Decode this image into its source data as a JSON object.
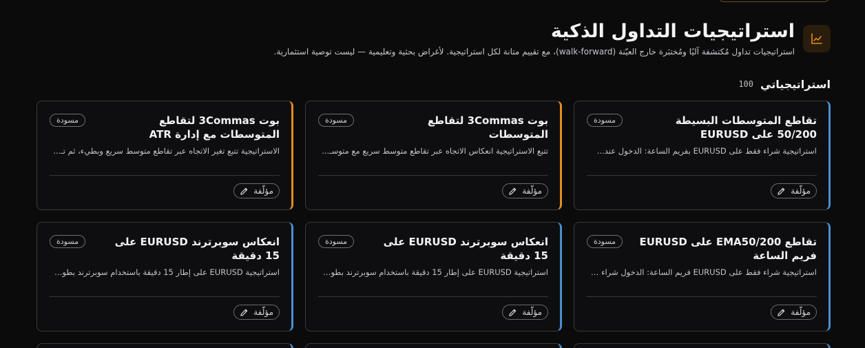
{
  "header": {
    "title": "استراتيجيات التداول الذكية",
    "subtitle": "استراتيجيات تداول مُكتشفة آليًا ومُختبَرة خارج العيّنة (walk-forward)، مع تقييم متانة لكل استراتيجية. لأغراض بحثية وتعليمية — ليست توصية استثمارية.",
    "icon": "chart-line-icon",
    "accent_color": "#e28e1f"
  },
  "section": {
    "title": "استراتيجياتي",
    "count": "100"
  },
  "cards": [
    {
      "title": "تقاطع المتوسطات البسيطة 50/200 على EURUSD",
      "badge": "مسودة",
      "description": "استراتيجية شراء فقط على EURUSD بفريم الساعة: الدخول عند...",
      "author_label": "مؤلّفة",
      "accent": "blue"
    },
    {
      "title": "بوت 3Commas لتقاطع المتوسطات",
      "badge": "مسودة",
      "description": "تتبع الاستراتيجية انعكاس الاتجاه عبر تقاطع متوسط سريع مع متوسـ...",
      "author_label": "مؤلّفة",
      "accent": "orange"
    },
    {
      "title": "بوت 3Commas لتقاطع المتوسطات مع إدارة ATR",
      "badge": "مسودة",
      "description": "الاستراتيجية تتبع تغير الاتجاه عبر تقاطع متوسط سريع وبطيء، ثم تـ...",
      "author_label": "مؤلّفة",
      "accent": "orange"
    },
    {
      "title": "تقاطع EMA50/200 على EURUSD فريم الساعة",
      "badge": "مسودة",
      "description": "استراتيجية شراء فقط على EURUSD فريم الساعة: الدخول شراء عند...",
      "author_label": "مؤلّفة",
      "accent": "blue"
    },
    {
      "title": "انعكاس سوبرترند EURUSD على 15 دقيقة",
      "badge": "مسودة",
      "description": "استراتيجية EURUSD على إطار 15 دقيقة باستخدام سوبرترند بطول R...",
      "author_label": "مؤلّفة",
      "accent": "blue"
    },
    {
      "title": "انعكاس سوبرترند EURUSD على 15 دقيقة",
      "badge": "مسودة",
      "description": "استراتيجية EURUSD على إطار 15 دقيقة باستخدام سوبرترند بطول R...",
      "author_label": "مؤلّفة",
      "accent": "blue"
    }
  ],
  "colors": {
    "blue_accent": "#4a8fd0",
    "orange_accent": "#e28e1f",
    "background": "#0b0b0c"
  }
}
